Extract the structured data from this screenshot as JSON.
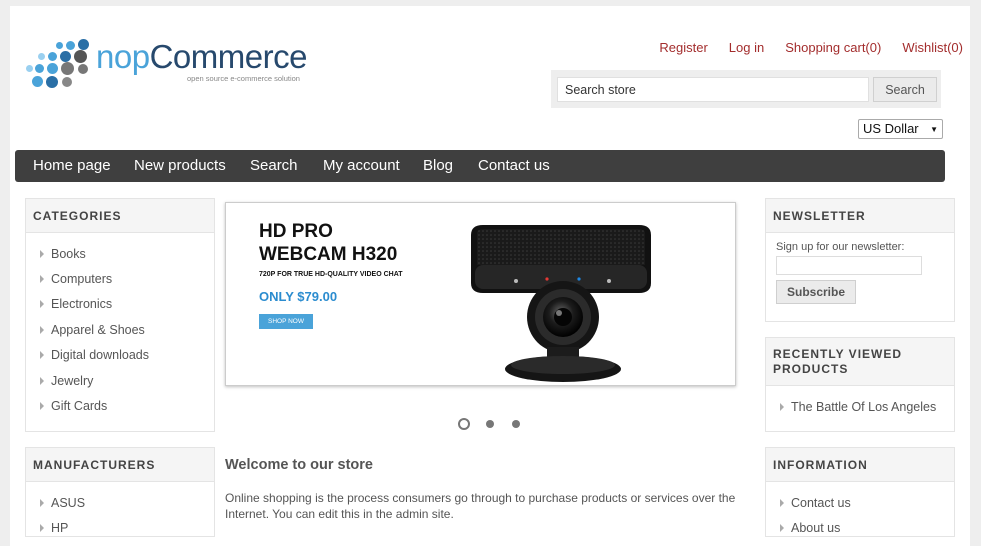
{
  "header": {
    "logo_word_prefix": "nop",
    "logo_word_suffix": "Commerce",
    "logo_tagline": "open source e-commerce solution",
    "links": [
      "Register",
      "Log in",
      "Shopping cart(0)",
      "Wishlist(0)"
    ]
  },
  "search": {
    "value": "Search store",
    "button_label": "Search"
  },
  "currency": {
    "selected": "US Dollar"
  },
  "nav": [
    "Home page",
    "New products",
    "Search",
    "My account",
    "Blog",
    "Contact us"
  ],
  "categories": {
    "title": "Categories",
    "items": [
      "Books",
      "Computers",
      "Electronics",
      "Apparel & Shoes",
      "Digital downloads",
      "Jewelry",
      "Gift Cards"
    ]
  },
  "manufacturers": {
    "title": "Manufacturers",
    "items": [
      "ASUS",
      "HP"
    ]
  },
  "slider": {
    "title_line1": "HD PRO",
    "title_line2": "WEBCAM H320",
    "subtitle": "720P FOR TRUE HD-QUALITY VIDEO CHAT",
    "price": "ONLY $79.00",
    "button_label": "SHOP NOW",
    "slide_count": 3,
    "active_slide": 1
  },
  "welcome": {
    "title": "Welcome to our store",
    "text": "Online shopping is the process consumers go through to purchase products or services over the Internet. You can edit this in the admin site."
  },
  "newsletter": {
    "title": "Newsletter",
    "label": "Sign up for our newsletter:",
    "button_label": "Subscribe"
  },
  "recently_viewed": {
    "title": "Recently viewed products",
    "items": [
      "The Battle Of Los Angeles"
    ]
  },
  "information": {
    "title": "Information",
    "items": [
      "Contact us",
      "About us"
    ]
  },
  "colors": {
    "accent_blue": "#4aa3d9",
    "link_red": "#a32d2d",
    "nav_bg": "#3f3f3f"
  }
}
